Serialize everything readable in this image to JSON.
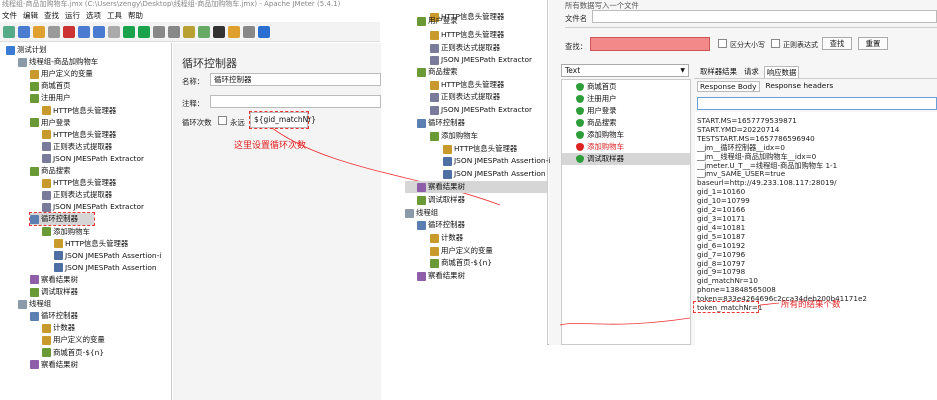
{
  "window": {
    "title": "线程组-商品加购物车.jmx (C:\\Users\\zengy\\Desktop\\线程组-商品加购物车.jmx) - Apache JMeter (5.4.1)"
  },
  "menu": [
    "文件",
    "编辑",
    "查找",
    "运行",
    "选项",
    "工具",
    "帮助"
  ],
  "left_tree": [
    {
      "label": "测试计划",
      "icon": "test-plan-icon"
    },
    {
      "label": "线程组-商品加购物车",
      "icon": "thread-group-icon"
    },
    {
      "label": "用户定义的变量",
      "icon": "tools-icon"
    },
    {
      "label": "商城首页",
      "icon": "sampler-icon"
    },
    {
      "label": "注册用户",
      "icon": "sampler-icon"
    },
    {
      "label": "HTTP信息头管理器",
      "icon": "tools-icon"
    },
    {
      "label": "用户登录",
      "icon": "sampler-icon"
    },
    {
      "label": "HTTP信息头管理器",
      "icon": "tools-icon"
    },
    {
      "label": "正则表达式提取器",
      "icon": "extractor-icon"
    },
    {
      "label": "JSON JMESPath Extractor",
      "icon": "extractor-icon"
    },
    {
      "label": "商品搜索",
      "icon": "sampler-icon"
    },
    {
      "label": "HTTP信息头管理器",
      "icon": "tools-icon"
    },
    {
      "label": "正则表达式提取器",
      "icon": "extractor-icon"
    },
    {
      "label": "JSON JMESPath Extractor",
      "icon": "extractor-icon"
    },
    {
      "label": "循环控制器",
      "icon": "loop-icon"
    },
    {
      "label": "添加购物车",
      "icon": "sampler-icon"
    },
    {
      "label": "HTTP信息头管理器",
      "icon": "tools-icon"
    },
    {
      "label": "JSON JMESPath Assertion-i",
      "icon": "assertion-icon"
    },
    {
      "label": "JSON JMESPath Assertion",
      "icon": "assertion-icon"
    },
    {
      "label": "察看结果树",
      "icon": "listener-icon"
    },
    {
      "label": "调试取样器",
      "icon": "sampler-icon"
    },
    {
      "label": "线程组",
      "icon": "thread-group-icon"
    },
    {
      "label": "循环控制器",
      "icon": "loop-icon"
    },
    {
      "label": "计数器",
      "icon": "tools-icon"
    },
    {
      "label": "用户定义的变量",
      "icon": "tools-icon"
    },
    {
      "label": "商城首页-${n}",
      "icon": "sampler-icon"
    },
    {
      "label": "察看结果树",
      "icon": "listener-icon"
    }
  ],
  "panel": {
    "title": "循环控制器",
    "name_label": "名称：",
    "name_value": "循环控制器",
    "comment_label": "注释：",
    "loop_label": "循环次数",
    "forever_label": "永远",
    "loop_value": "${gid_matchNr}",
    "annotation": "这里设置循环次数"
  },
  "mid_tree": [
    {
      "label": "HTTP信息头管理器",
      "icon": "tools-icon"
    },
    {
      "label": "用户登录",
      "icon": "sampler-icon"
    },
    {
      "label": "HTTP信息头管理器",
      "icon": "tools-icon"
    },
    {
      "label": "正则表达式提取器",
      "icon": "extractor-icon"
    },
    {
      "label": "JSON JMESPath Extractor",
      "icon": "extractor-icon"
    },
    {
      "label": "商品搜索",
      "icon": "sampler-icon"
    },
    {
      "label": "HTTP信息头管理器",
      "icon": "tools-icon"
    },
    {
      "label": "正则表达式提取器",
      "icon": "extractor-icon"
    },
    {
      "label": "JSON JMESPath Extractor",
      "icon": "extractor-icon"
    },
    {
      "label": "循环控制器",
      "icon": "loop-icon"
    },
    {
      "label": "添加购物车",
      "icon": "sampler-icon"
    },
    {
      "label": "HTTP信息头管理器",
      "icon": "tools-icon"
    },
    {
      "label": "JSON JMESPath Assertion-i",
      "icon": "assertion-icon"
    },
    {
      "label": "JSON JMESPath Assertion",
      "icon": "assertion-icon"
    },
    {
      "label": "察看结果树",
      "icon": "listener-icon"
    },
    {
      "label": "调试取样器",
      "icon": "sampler-icon"
    },
    {
      "label": "线程组",
      "icon": "thread-group-icon"
    },
    {
      "label": "循环控制器",
      "icon": "loop-icon"
    },
    {
      "label": "计数器",
      "icon": "tools-icon"
    },
    {
      "label": "用户定义的变量",
      "icon": "tools-icon"
    },
    {
      "label": "商城首页-${n}",
      "icon": "sampler-icon"
    },
    {
      "label": "察看结果树",
      "icon": "listener-icon"
    }
  ],
  "results": {
    "header_partial": "所有数据写入一个文件",
    "filename_label": "文件名",
    "search_label": "查找：",
    "case_label": "区分大小写",
    "regex_label": "正则表达式",
    "find_button": "查找",
    "reset_button": "重置",
    "renderer": "Text",
    "tabs": [
      "取样器结果",
      "请求",
      "响应数据"
    ],
    "subtabs": [
      "Response Body",
      "Response headers"
    ],
    "samples": [
      {
        "label": "商城首页",
        "status": "ok"
      },
      {
        "label": "注册用户",
        "status": "ok"
      },
      {
        "label": "用户登录",
        "status": "ok"
      },
      {
        "label": "商品搜索",
        "status": "ok"
      },
      {
        "label": "添加购物车",
        "status": "ok"
      },
      {
        "label": "添加购物车",
        "status": "fail"
      },
      {
        "label": "调试取样器",
        "status": "ok"
      }
    ],
    "body_lines": [
      "START.MS=1657779539871",
      "START.YMD=20220714",
      "TESTSTART.MS=1657786596940",
      "__jm__循环控制器__idx=0",
      "__jm__线程组-商品加购物车__idx=0",
      "__jmeter.U_T__=线程组-商品加购物车 1-1",
      "__jmv_SAME_USER=true",
      "baseurl=http://49.233.108.117:28019/",
      "gid_1=10160",
      "gid_10=10799",
      "gid_2=10166",
      "gid_3=10171",
      "gid_4=10181",
      "gid_5=10187",
      "gid_6=10192",
      "gid_7=10796",
      "gid_8=10797",
      "gid_9=10798",
      "gid_matchNr=10",
      "phone=13848565008",
      "token=833e4264696c2cca34deb200b41171e2",
      "token_matchNr=1"
    ],
    "annotation": "所有的结果个数",
    "colors": {
      "ok": "#2e9e3a",
      "fail": "#d22",
      "search_fill": "#f4898a"
    }
  }
}
